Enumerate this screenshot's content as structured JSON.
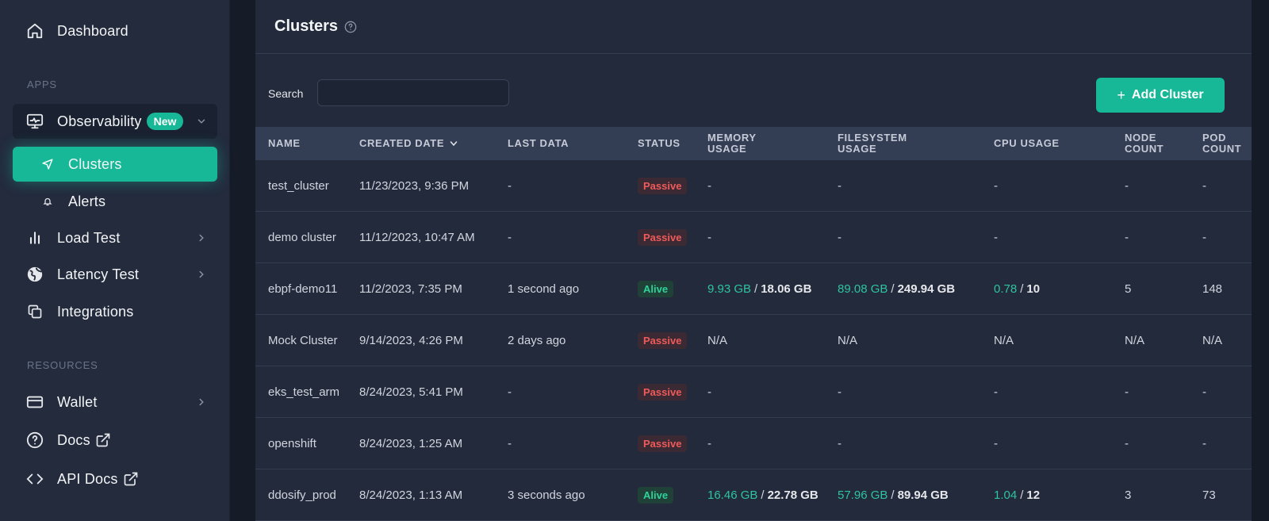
{
  "sidebar": {
    "dashboard": "Dashboard",
    "apps_label": "APPS",
    "observability": "Observability",
    "new_badge": "New",
    "clusters": "Clusters",
    "alerts": "Alerts",
    "load_test": "Load Test",
    "latency_test": "Latency Test",
    "integrations": "Integrations",
    "resources_label": "RESOURCES",
    "wallet": "Wallet",
    "docs": "Docs",
    "api_docs": "API Docs"
  },
  "header": {
    "title": "Clusters"
  },
  "toolbar": {
    "search_label": "Search",
    "search_value": "",
    "add_label": "Add Cluster"
  },
  "table": {
    "columns": [
      {
        "line1": "NAME",
        "line2": ""
      },
      {
        "line1": "CREATED DATE",
        "line2": ""
      },
      {
        "line1": "LAST DATA",
        "line2": ""
      },
      {
        "line1": "STATUS",
        "line2": ""
      },
      {
        "line1": "MEMORY",
        "line2": "USAGE"
      },
      {
        "line1": "FILESYSTEM",
        "line2": "USAGE"
      },
      {
        "line1": "CPU USAGE",
        "line2": ""
      },
      {
        "line1": "NODE",
        "line2": "COUNT"
      },
      {
        "line1": "POD",
        "line2": "COUNT"
      }
    ],
    "rows": [
      {
        "name": "test_cluster",
        "created": "11/23/2023, 9:36 PM",
        "last_data": "-",
        "status": "Passive",
        "status_type": "passive",
        "mem_used": "",
        "mem_total": "",
        "mem_text": "-",
        "fs_used": "",
        "fs_total": "",
        "fs_text": "-",
        "cpu_used": "",
        "cpu_total": "",
        "cpu_text": "-",
        "nodes": "-",
        "pods": "-"
      },
      {
        "name": "demo cluster",
        "created": "11/12/2023, 10:47 AM",
        "last_data": "-",
        "status": "Passive",
        "status_type": "passive",
        "mem_used": "",
        "mem_total": "",
        "mem_text": "-",
        "fs_used": "",
        "fs_total": "",
        "fs_text": "-",
        "cpu_used": "",
        "cpu_total": "",
        "cpu_text": "-",
        "nodes": "-",
        "pods": "-"
      },
      {
        "name": "ebpf-demo11",
        "created": "11/2/2023, 7:35 PM",
        "last_data": "1 second ago",
        "status": "Alive",
        "status_type": "alive",
        "mem_used": "9.93 GB",
        "mem_total": "18.06 GB",
        "mem_text": "",
        "fs_used": "89.08 GB",
        "fs_total": "249.94 GB",
        "fs_text": "",
        "cpu_used": "0.78",
        "cpu_total": "10",
        "cpu_text": "",
        "nodes": "5",
        "pods": "148"
      },
      {
        "name": "Mock Cluster",
        "created": "9/14/2023, 4:26 PM",
        "last_data": "2 days ago",
        "status": "Passive",
        "status_type": "passive",
        "mem_used": "",
        "mem_total": "",
        "mem_text": "N/A",
        "fs_used": "",
        "fs_total": "",
        "fs_text": "N/A",
        "cpu_used": "",
        "cpu_total": "",
        "cpu_text": "N/A",
        "nodes": "N/A",
        "pods": "N/A"
      },
      {
        "name": "eks_test_arm",
        "created": "8/24/2023, 5:41 PM",
        "last_data": "-",
        "status": "Passive",
        "status_type": "passive",
        "mem_used": "",
        "mem_total": "",
        "mem_text": "-",
        "fs_used": "",
        "fs_total": "",
        "fs_text": "-",
        "cpu_used": "",
        "cpu_total": "",
        "cpu_text": "-",
        "nodes": "-",
        "pods": "-"
      },
      {
        "name": "openshift",
        "created": "8/24/2023, 1:25 AM",
        "last_data": "-",
        "status": "Passive",
        "status_type": "passive",
        "mem_used": "",
        "mem_total": "",
        "mem_text": "-",
        "fs_used": "",
        "fs_total": "",
        "fs_text": "-",
        "cpu_used": "",
        "cpu_total": "",
        "cpu_text": "-",
        "nodes": "-",
        "pods": "-"
      },
      {
        "name": "ddosify_prod",
        "created": "8/24/2023, 1:13 AM",
        "last_data": "3 seconds ago",
        "status": "Alive",
        "status_type": "alive",
        "mem_used": "16.46 GB",
        "mem_total": "22.78 GB",
        "mem_text": "",
        "fs_used": "57.96 GB",
        "fs_total": "89.94 GB",
        "fs_text": "",
        "cpu_used": "1.04",
        "cpu_total": "12",
        "cpu_text": "",
        "nodes": "3",
        "pods": "73"
      }
    ]
  },
  "colors": {
    "accent": "#17b897",
    "passive": "#ef5a5a",
    "alive": "#2fd39a"
  },
  "icons": [
    "home-icon",
    "monitor-icon",
    "chevron-down-icon",
    "send-icon",
    "bell-icon",
    "bar-chart-icon",
    "chevron-right-icon",
    "globe-icon",
    "copy-icon",
    "wallet-icon",
    "help-circle-icon",
    "external-link-icon",
    "code-icon",
    "plus-icon",
    "sort-down-icon"
  ]
}
